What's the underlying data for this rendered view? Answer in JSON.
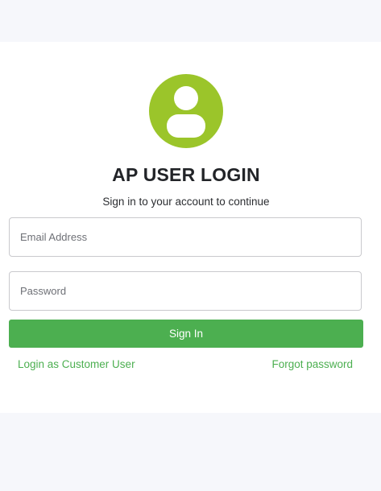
{
  "login": {
    "title": "AP USER LOGIN",
    "subtitle": "Sign in to your account to continue",
    "email_placeholder": "Email Address",
    "email_value": "",
    "password_placeholder": "Password",
    "password_value": "",
    "signin_label": "Sign In",
    "customer_link": "Login as Customer User",
    "forgot_link": "Forgot password"
  },
  "icons": {
    "avatar": "user-avatar-icon"
  },
  "colors": {
    "avatar_bg": "#9bc52a",
    "accent": "#4caf50",
    "page_bg": "#f6f7fb"
  }
}
